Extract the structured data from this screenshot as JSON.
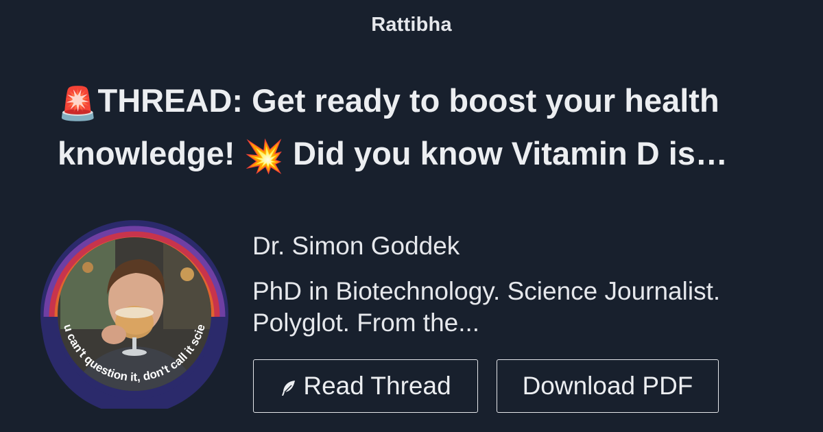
{
  "header": {
    "site_name": "Rattibha"
  },
  "thread": {
    "title_emoji_1": "🚨",
    "title_part_1": "THREAD: Get ready to boost your health knowledge! ",
    "title_emoji_2": "💥",
    "title_part_2": " Did you know Vitamin D is…"
  },
  "author": {
    "name": "Dr. Simon Goddek",
    "bio": "PhD in Biotechnology. Science Journalist. Polyglot. From the...",
    "avatar_ring_text": "If you can't question it, don't call it science!"
  },
  "actions": {
    "read_thread_label": "Read Thread",
    "read_thread_icon": "feather-icon",
    "download_pdf_label": "Download PDF"
  },
  "colors": {
    "background": "#18202d",
    "text": "#e8eaed",
    "avatar_ring": "#2b2a6b"
  }
}
